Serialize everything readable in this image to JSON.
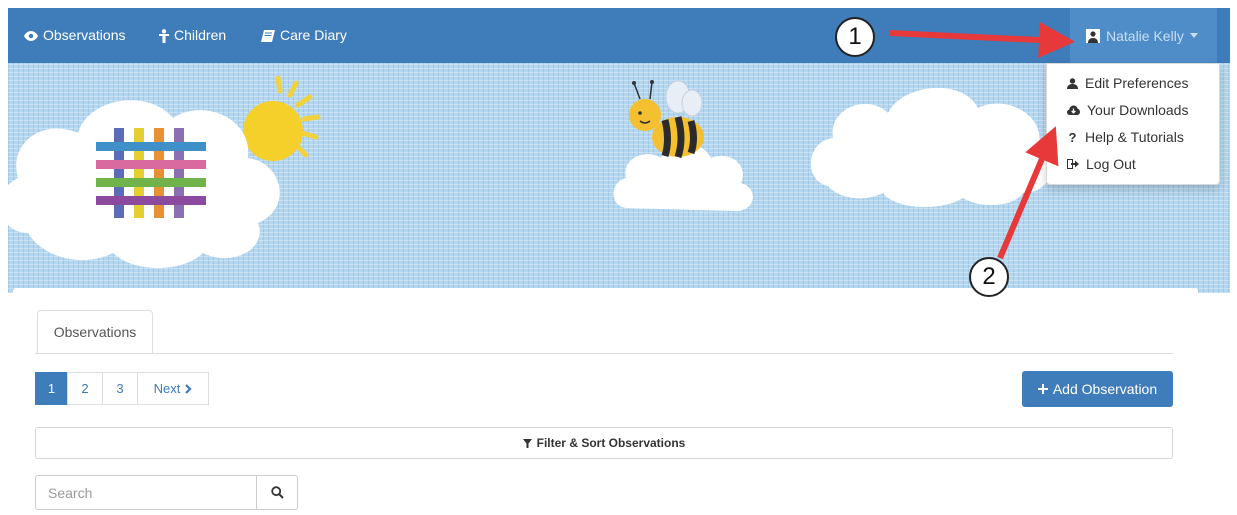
{
  "navbar": {
    "items": [
      {
        "label": "Observations",
        "icon": "eye-icon"
      },
      {
        "label": "Children",
        "icon": "child-icon"
      },
      {
        "label": "Care Diary",
        "icon": "book-icon"
      }
    ],
    "user_name": "Natalie Kelly",
    "color": "#3e7cba"
  },
  "user_menu": {
    "items": [
      {
        "label": "Edit Preferences",
        "icon": "user-icon"
      },
      {
        "label": "Your Downloads",
        "icon": "cloud-download-icon"
      },
      {
        "label": "Help & Tutorials",
        "icon": "question-icon"
      },
      {
        "label": "Log Out",
        "icon": "logout-icon"
      }
    ]
  },
  "tabs": [
    {
      "label": "Observations",
      "active": true
    }
  ],
  "pagination": {
    "pages": [
      "1",
      "2",
      "3"
    ],
    "current": "1",
    "next_label": "Next"
  },
  "add_button": {
    "label": "Add Observation"
  },
  "filter": {
    "label": "Filter & Sort Observations"
  },
  "search": {
    "placeholder": "Search"
  },
  "annotations": [
    "1",
    "2"
  ],
  "colors": {
    "primary": "#3e7cba",
    "banner_sky": "#b4d6ee",
    "annotation_arrow": "#e8393a"
  }
}
